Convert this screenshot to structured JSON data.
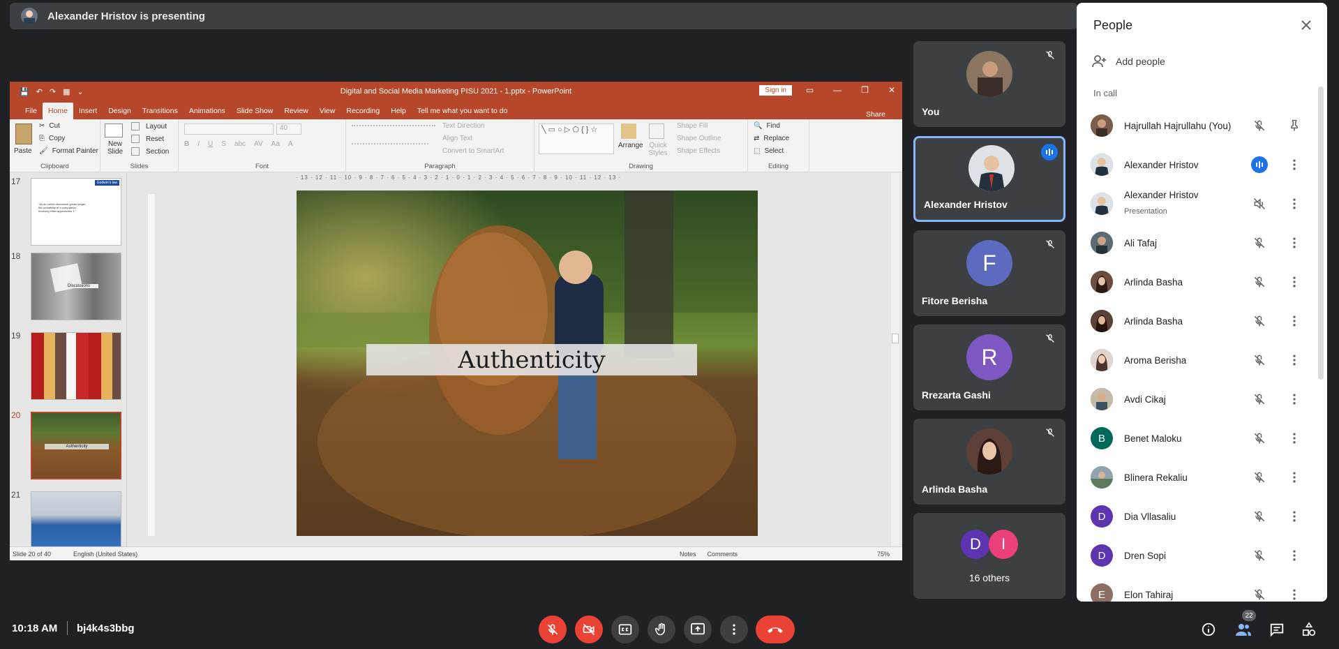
{
  "banner": {
    "text": "Alexander Hristov is presenting"
  },
  "ppt": {
    "quick_access": [
      "💾",
      "↶",
      "↷",
      "▦",
      "⌄"
    ],
    "doc_title": "Digital and Social Media Marketing PISU 2021 - 1.pptx  -  PowerPoint",
    "sign_in": "Sign in",
    "window_controls": [
      "▭",
      "—",
      "❐",
      "✕"
    ],
    "tabs": [
      "File",
      "Home",
      "Insert",
      "Design",
      "Transitions",
      "Animations",
      "Slide Show",
      "Review",
      "View",
      "Recording",
      "Help",
      "Tell me what you want to do"
    ],
    "share": "Share",
    "ribbon": {
      "paste": "Paste",
      "cut": "Cut",
      "copy": "Copy",
      "format_painter": "Format Painter",
      "clipboard": "Clipboard",
      "new_slide": "New Slide",
      "layout": "Layout",
      "reset": "Reset",
      "section": "Section",
      "slides": "Slides",
      "font_size": "40",
      "font": "Font",
      "font_styles": [
        "B",
        "I",
        "U",
        "S",
        "abc",
        "AV",
        "Aa",
        "A"
      ],
      "text_direction": "Text Direction",
      "align_text": "Align Text",
      "convert_smartart": "Convert to SmartArt",
      "paragraph": "Paragraph",
      "arrange": "Arrange",
      "quick_styles": "Quick Styles",
      "shape_fill": "Shape Fill",
      "shape_outline": "Shape Outline",
      "shape_effects": "Shape Effects",
      "drawing": "Drawing",
      "find": "Find",
      "replace": "Replace",
      "select": "Select",
      "editing": "Editing"
    },
    "ruler_h": "· 13 · 12 · 11 · 10 · 9 · 8 · 7 · 6 · 5 · 4 · 3 · 2 · 1 · 0 · 1 · 2 · 3 · 4 · 5 · 6 · 7 · 8 · 9 · 10 · 11 · 12 · 13 ·",
    "thumbnails": [
      {
        "num": "17",
        "text": "\"As an online discussion grows longer, the probability of a comparison involving Hitler approaches 1.\"",
        "header": "Godwin's law",
        "selected": false
      },
      {
        "num": "18",
        "text": "Discussions",
        "selected": false
      },
      {
        "num": "19",
        "text": "",
        "selected": false
      },
      {
        "num": "20",
        "text": "Authenticity",
        "selected": true
      },
      {
        "num": "21",
        "text": "",
        "selected": false
      }
    ],
    "slide_title": "Authenticity",
    "status": {
      "slide": "Slide 20 of 40",
      "language": "English (United States)",
      "notes": "Notes",
      "comments": "Comments",
      "zoom": "75%"
    }
  },
  "tiles": [
    {
      "name": "You",
      "muted": true
    },
    {
      "name": "Alexander Hristov",
      "speaking": true
    },
    {
      "name": "Fitore Berisha",
      "initial": "F",
      "color": "#5c6bc0",
      "muted": true
    },
    {
      "name": "Rrezarta Gashi",
      "initial": "R",
      "color": "#7e57c2",
      "muted": true
    },
    {
      "name": "Arlinda Basha",
      "muted": true
    },
    {
      "name": "16 others",
      "initials": [
        "D",
        "I"
      ],
      "colors": [
        "#5e35b1",
        "#ec407a"
      ]
    }
  ],
  "people": {
    "title": "People",
    "add": "Add people",
    "in_call": "In call",
    "list": [
      {
        "name": "Hajrullah Hajrullahu (You)",
        "sub": "",
        "avatar": "photo",
        "color": "#8d6e63",
        "action": "pin"
      },
      {
        "name": "Alexander Hristov",
        "sub": "",
        "avatar": "photo",
        "color": "#546e7a",
        "speaking": true
      },
      {
        "name": "Alexander Hristov",
        "sub": "Presentation",
        "avatar": "photo",
        "color": "#546e7a",
        "presentation": true
      },
      {
        "name": "Ali Tafaj",
        "sub": "",
        "avatar": "photo",
        "color": "#455a64"
      },
      {
        "name": "Arlinda Basha",
        "sub": "",
        "avatar": "photo",
        "color": "#6d4c41"
      },
      {
        "name": "Arlinda Basha",
        "sub": "",
        "avatar": "photo",
        "color": "#5d4037"
      },
      {
        "name": "Aroma Berisha",
        "sub": "",
        "avatar": "photo",
        "color": "#a1887f"
      },
      {
        "name": "Avdi Cikaj",
        "sub": "",
        "avatar": "photo",
        "color": "#8d6e63"
      },
      {
        "name": "Benet Maloku",
        "sub": "",
        "initial": "B",
        "color": "#00695c"
      },
      {
        "name": "Blinera Rekaliu",
        "sub": "",
        "avatar": "photo",
        "color": "#78909c"
      },
      {
        "name": "Dia Vllasaliu",
        "sub": "",
        "initial": "D",
        "color": "#5e35b1"
      },
      {
        "name": "Dren Sopi",
        "sub": "",
        "initial": "D",
        "color": "#5e35b1"
      },
      {
        "name": "Elon Tahiraj",
        "sub": "",
        "initial": "E",
        "color": "#8d6e63"
      }
    ]
  },
  "bottom": {
    "time": "10:18 AM",
    "code": "bj4k4s3bbg",
    "people_count": "22"
  }
}
